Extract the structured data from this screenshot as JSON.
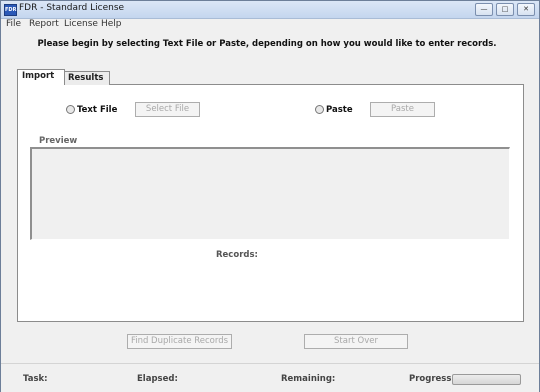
{
  "window": {
    "title": "FDR - Standard License",
    "app_icon_text": "FDR"
  },
  "menu": {
    "file": "File",
    "report": "Report",
    "license": "License",
    "help": "Help"
  },
  "instruction": "Please begin by selecting Text File or Paste, depending on how you would like to enter records.",
  "tabs": {
    "import": "Import",
    "results": "Results"
  },
  "import": {
    "text_file_label": "Text File",
    "select_file_button": "Select File",
    "paste_label": "Paste",
    "paste_button": "Paste",
    "preview_label": "Preview",
    "records_label": "Records:"
  },
  "actions": {
    "find_duplicates": "Find Duplicate Records",
    "start_over": "Start Over"
  },
  "status": {
    "task": "Task:",
    "elapsed": "Elapsed:",
    "remaining": "Remaining:",
    "progress": "Progress:",
    "progress_value": 0
  }
}
